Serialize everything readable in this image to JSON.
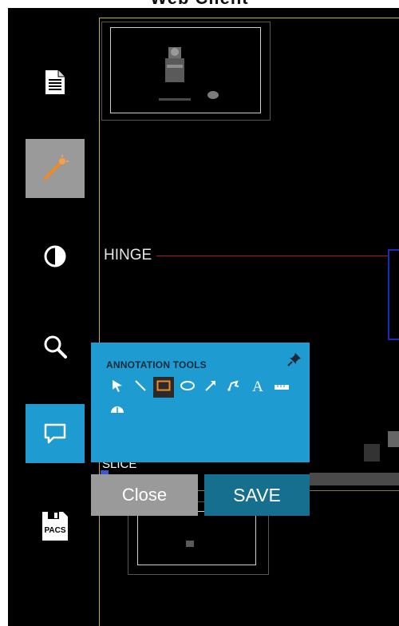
{
  "header": {
    "title": "Web Client"
  },
  "sidebar": {
    "items": [
      {
        "name": "report",
        "icon": "document-icon"
      },
      {
        "name": "tools",
        "icon": "magic-wand-icon",
        "state": "active"
      },
      {
        "name": "contrast",
        "icon": "contrast-icon"
      },
      {
        "name": "zoom",
        "icon": "magnifier-icon"
      },
      {
        "name": "annotations",
        "icon": "comment-icon",
        "state": "active"
      },
      {
        "name": "pacs",
        "icon": "save-pacs-icon",
        "label": "PACS"
      }
    ]
  },
  "viewer": {
    "hinge_label": "HINGE",
    "slice_label": "SLICE"
  },
  "annotation_panel": {
    "title": "ANNOTATION TOOLS",
    "tools": [
      {
        "name": "arrow-select",
        "icon": "cursor-arrow-icon"
      },
      {
        "name": "line",
        "icon": "line-icon"
      },
      {
        "name": "rectangle",
        "icon": "rectangle-icon",
        "selected": true
      },
      {
        "name": "ellipse",
        "icon": "ellipse-icon"
      },
      {
        "name": "arrow",
        "icon": "arrow-icon"
      },
      {
        "name": "freehand",
        "icon": "freehand-icon"
      },
      {
        "name": "text",
        "icon": "text-icon",
        "glyph": "A"
      },
      {
        "name": "ruler",
        "icon": "ruler-icon"
      },
      {
        "name": "protractor",
        "icon": "protractor-icon"
      }
    ]
  },
  "buttons": {
    "close": "Close",
    "save": "SAVE"
  },
  "colors": {
    "accent_blue": "#1e9bd1",
    "save_blue": "#176f8f",
    "button_gray": "#9a9a9a",
    "selected_tool_orange": "#f08a24",
    "hinge_line_red": "#a02020"
  }
}
